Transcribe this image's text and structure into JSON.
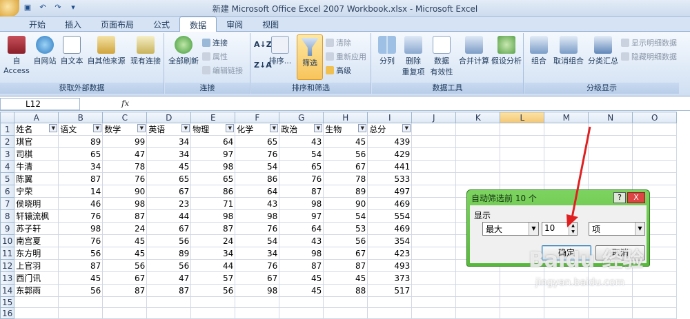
{
  "window": {
    "title": "新建 Microsoft Office Excel 2007 Workbook.xlsx - Microsoft Excel"
  },
  "tabs": [
    "开始",
    "插入",
    "页面布局",
    "公式",
    "数据",
    "审阅",
    "视图"
  ],
  "active_tab": "数据",
  "ribbon": {
    "get_external": {
      "access": "自 Access",
      "web": "自网站",
      "text": "自文本",
      "other": "自其他来源",
      "existing": "现有连接",
      "label": "获取外部数据"
    },
    "connections": {
      "refresh_all": "全部刷新",
      "connections": "连接",
      "properties": "属性",
      "edit_links": "编辑链接",
      "label": "连接"
    },
    "sort_filter": {
      "sort": "排序...",
      "filter": "筛选",
      "clear": "清除",
      "reapply": "重新应用",
      "advanced": "高级",
      "label": "排序和筛选"
    },
    "data_tools": {
      "split": "分列",
      "remove_dup_1": "删除",
      "remove_dup_2": "重复项",
      "validation_1": "数据",
      "validation_2": "有效性",
      "consolidate": "合并计算",
      "whatif": "假设分析",
      "label": "数据工具"
    },
    "outline": {
      "group": "组合",
      "ungroup": "取消组合",
      "subtotal": "分类汇总",
      "show_detail": "显示明细数据",
      "hide_detail": "隐藏明细数据",
      "label": "分级显示"
    }
  },
  "formula_bar": {
    "name_box": "L12",
    "fx": "fx",
    "content": ""
  },
  "sheet": {
    "columns": [
      "A",
      "B",
      "C",
      "D",
      "E",
      "F",
      "G",
      "H",
      "I",
      "J",
      "K",
      "L",
      "M",
      "N",
      "O"
    ],
    "headers": [
      "姓名",
      "语文",
      "数学",
      "英语",
      "物理",
      "化学",
      "政治",
      "生物",
      "总分"
    ],
    "rows": [
      [
        "琪官",
        "89",
        "99",
        "34",
        "64",
        "65",
        "43",
        "45",
        "439"
      ],
      [
        "司棋",
        "65",
        "47",
        "34",
        "97",
        "76",
        "54",
        "56",
        "429"
      ],
      [
        "牛清",
        "34",
        "78",
        "45",
        "98",
        "54",
        "65",
        "67",
        "441"
      ],
      [
        "陈翼",
        "87",
        "76",
        "65",
        "65",
        "86",
        "76",
        "78",
        "533"
      ],
      [
        "宁荣",
        "14",
        "90",
        "67",
        "86",
        "64",
        "87",
        "89",
        "497"
      ],
      [
        "侯晓明",
        "46",
        "98",
        "23",
        "71",
        "43",
        "98",
        "90",
        "469"
      ],
      [
        "轩辕流枫",
        "76",
        "87",
        "44",
        "98",
        "98",
        "97",
        "54",
        "554"
      ],
      [
        "苏子轩",
        "98",
        "24",
        "67",
        "87",
        "76",
        "64",
        "53",
        "469"
      ],
      [
        "南宫夏",
        "76",
        "45",
        "56",
        "24",
        "54",
        "43",
        "56",
        "354"
      ],
      [
        "东方明",
        "56",
        "45",
        "89",
        "34",
        "34",
        "98",
        "67",
        "423"
      ],
      [
        "上官羽",
        "87",
        "56",
        "56",
        "44",
        "76",
        "87",
        "87",
        "493"
      ],
      [
        "西门讯",
        "45",
        "67",
        "47",
        "57",
        "67",
        "45",
        "45",
        "373"
      ],
      [
        "东郭雨",
        "56",
        "87",
        "87",
        "56",
        "98",
        "45",
        "88",
        "517"
      ]
    ],
    "row_numbers": [
      "1",
      "2",
      "3",
      "4",
      "5",
      "6",
      "7",
      "8",
      "9",
      "10",
      "11",
      "12",
      "13",
      "14",
      "15",
      "16"
    ]
  },
  "dialog": {
    "title": "自动筛选前 10 个",
    "help": "?",
    "close": "X",
    "section": "显示",
    "mode": "最大",
    "count": "10",
    "unit": "项",
    "ok": "确定",
    "cancel": "取消"
  },
  "watermark": {
    "main": "Baidu 经验",
    "sub": "jingyan.baidu.com"
  },
  "colors": {
    "accent": "#d99a2a",
    "dialog_frame": "#57b93a",
    "arrow": "#e02020"
  }
}
